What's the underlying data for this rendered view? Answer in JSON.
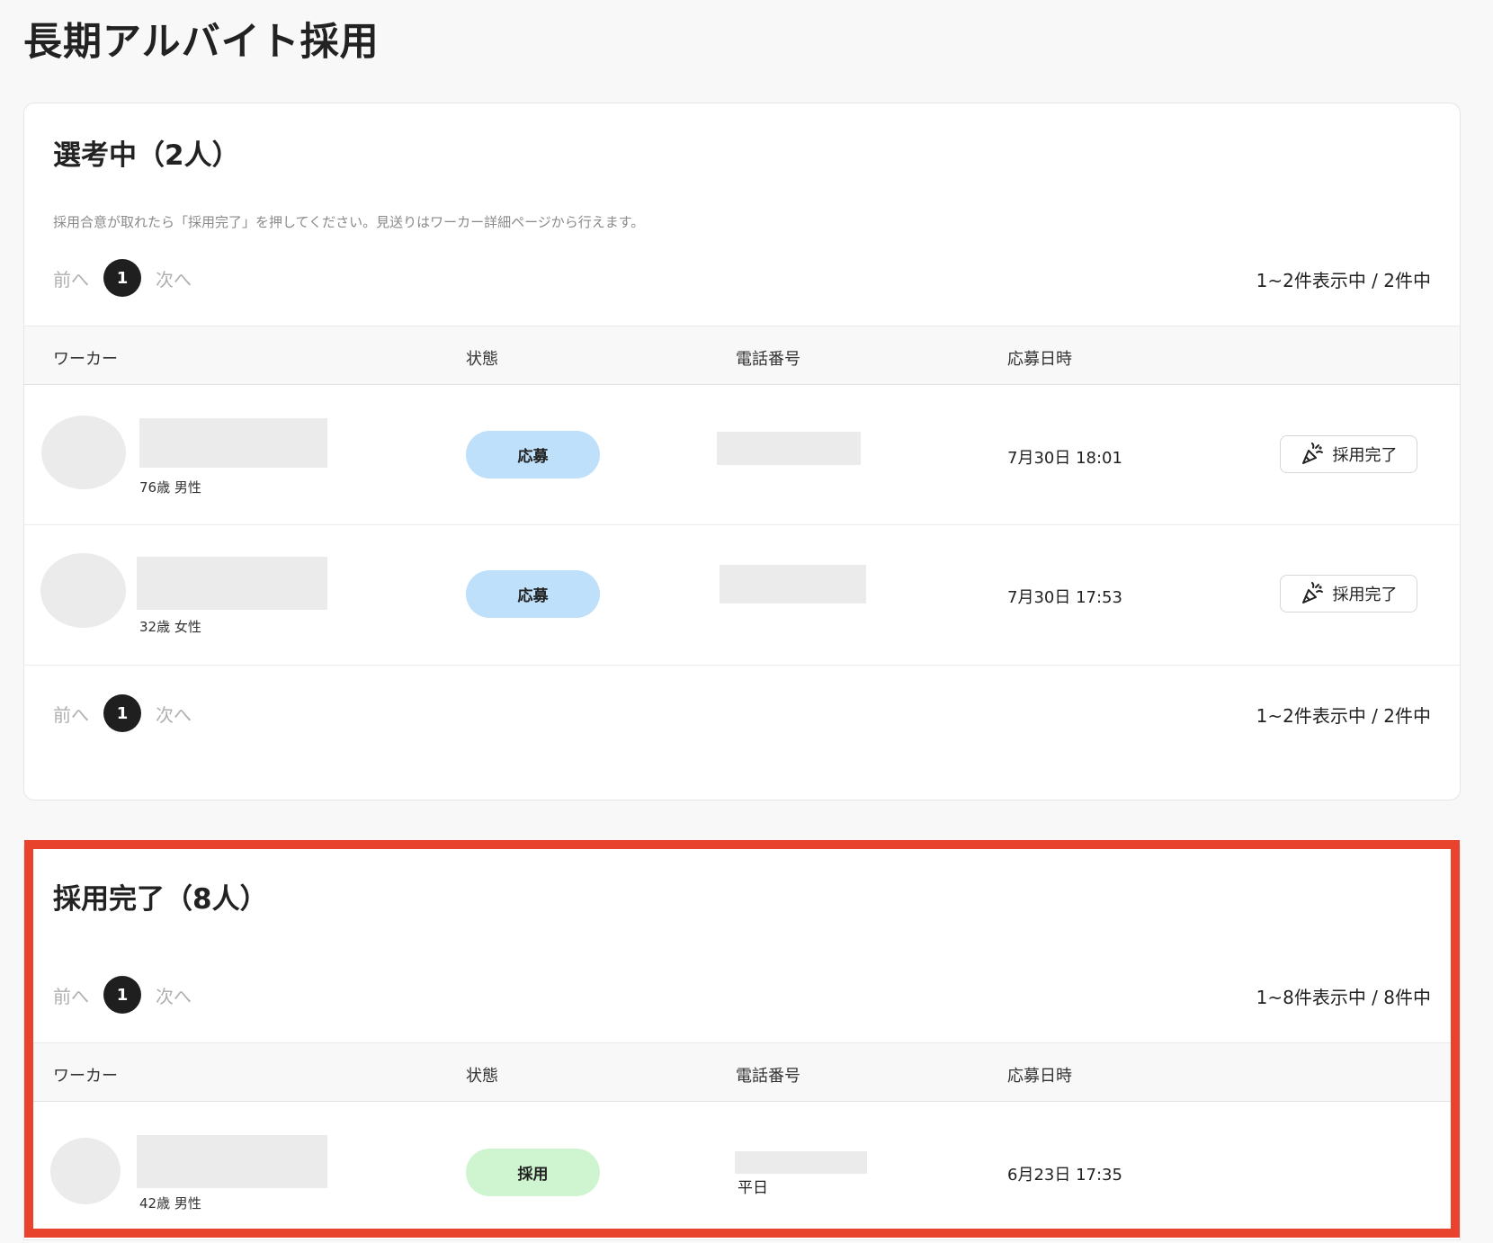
{
  "page": {
    "title": "長期アルバイト採用"
  },
  "selecting": {
    "title": "選考中（2人）",
    "hint": "採用合意が取れたら「採用完了」を押してください。見送りはワーカー詳細ページから行えます。",
    "pager": {
      "prev": "前へ",
      "page": "1",
      "next": "次へ"
    },
    "count": "1~2件表示中 / 2件中",
    "headers": {
      "worker": "ワーカー",
      "status": "状態",
      "phone": "電話番号",
      "date": "応募日時"
    },
    "rows": [
      {
        "meta": "76歳 男性",
        "status": "応募",
        "date": "7月30日 18:01",
        "action": "採用完了"
      },
      {
        "meta": "32歳 女性",
        "status": "応募",
        "date": "7月30日 17:53",
        "action": "採用完了"
      }
    ],
    "pager_bottom": {
      "prev": "前へ",
      "page": "1",
      "next": "次へ"
    },
    "count_bottom": "1~2件表示中 / 2件中"
  },
  "hired": {
    "title": "採用完了（8人）",
    "pager": {
      "prev": "前へ",
      "page": "1",
      "next": "次へ"
    },
    "count": "1~8件表示中 / 8件中",
    "headers": {
      "worker": "ワーカー",
      "status": "状態",
      "phone": "電話番号",
      "date": "応募日時"
    },
    "rows": [
      {
        "meta": "42歳 男性",
        "status": "採用",
        "phone_note": "平日",
        "date": "6月23日 17:35"
      }
    ]
  },
  "colors": {
    "applied_pill": "#bee0fb",
    "hired_pill": "#cff5d0",
    "highlight": "#e8432c",
    "page_active": "#1f1f1f"
  },
  "icons": {
    "hire_button": "party-popper-icon"
  }
}
